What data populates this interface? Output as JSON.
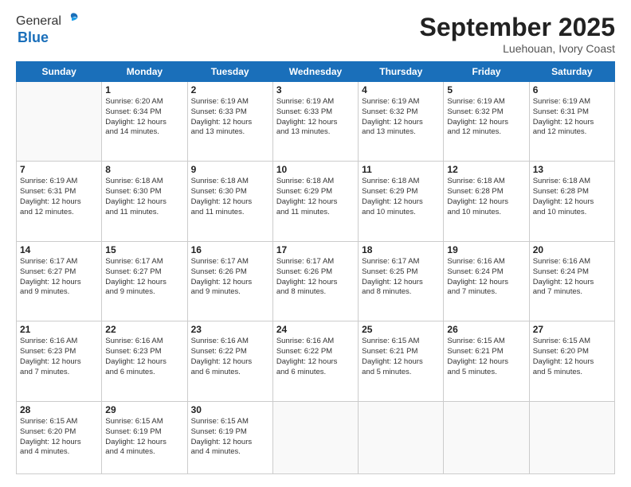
{
  "logo": {
    "general": "General",
    "blue": "Blue"
  },
  "header": {
    "month": "September 2025",
    "location": "Luehouan, Ivory Coast"
  },
  "weekdays": [
    "Sunday",
    "Monday",
    "Tuesday",
    "Wednesday",
    "Thursday",
    "Friday",
    "Saturday"
  ],
  "weeks": [
    [
      {
        "day": "",
        "info": ""
      },
      {
        "day": "1",
        "info": "Sunrise: 6:20 AM\nSunset: 6:34 PM\nDaylight: 12 hours\nand 14 minutes."
      },
      {
        "day": "2",
        "info": "Sunrise: 6:19 AM\nSunset: 6:33 PM\nDaylight: 12 hours\nand 13 minutes."
      },
      {
        "day": "3",
        "info": "Sunrise: 6:19 AM\nSunset: 6:33 PM\nDaylight: 12 hours\nand 13 minutes."
      },
      {
        "day": "4",
        "info": "Sunrise: 6:19 AM\nSunset: 6:32 PM\nDaylight: 12 hours\nand 13 minutes."
      },
      {
        "day": "5",
        "info": "Sunrise: 6:19 AM\nSunset: 6:32 PM\nDaylight: 12 hours\nand 12 minutes."
      },
      {
        "day": "6",
        "info": "Sunrise: 6:19 AM\nSunset: 6:31 PM\nDaylight: 12 hours\nand 12 minutes."
      }
    ],
    [
      {
        "day": "7",
        "info": "Sunrise: 6:19 AM\nSunset: 6:31 PM\nDaylight: 12 hours\nand 12 minutes."
      },
      {
        "day": "8",
        "info": "Sunrise: 6:18 AM\nSunset: 6:30 PM\nDaylight: 12 hours\nand 11 minutes."
      },
      {
        "day": "9",
        "info": "Sunrise: 6:18 AM\nSunset: 6:30 PM\nDaylight: 12 hours\nand 11 minutes."
      },
      {
        "day": "10",
        "info": "Sunrise: 6:18 AM\nSunset: 6:29 PM\nDaylight: 12 hours\nand 11 minutes."
      },
      {
        "day": "11",
        "info": "Sunrise: 6:18 AM\nSunset: 6:29 PM\nDaylight: 12 hours\nand 10 minutes."
      },
      {
        "day": "12",
        "info": "Sunrise: 6:18 AM\nSunset: 6:28 PM\nDaylight: 12 hours\nand 10 minutes."
      },
      {
        "day": "13",
        "info": "Sunrise: 6:18 AM\nSunset: 6:28 PM\nDaylight: 12 hours\nand 10 minutes."
      }
    ],
    [
      {
        "day": "14",
        "info": "Sunrise: 6:17 AM\nSunset: 6:27 PM\nDaylight: 12 hours\nand 9 minutes."
      },
      {
        "day": "15",
        "info": "Sunrise: 6:17 AM\nSunset: 6:27 PM\nDaylight: 12 hours\nand 9 minutes."
      },
      {
        "day": "16",
        "info": "Sunrise: 6:17 AM\nSunset: 6:26 PM\nDaylight: 12 hours\nand 9 minutes."
      },
      {
        "day": "17",
        "info": "Sunrise: 6:17 AM\nSunset: 6:26 PM\nDaylight: 12 hours\nand 8 minutes."
      },
      {
        "day": "18",
        "info": "Sunrise: 6:17 AM\nSunset: 6:25 PM\nDaylight: 12 hours\nand 8 minutes."
      },
      {
        "day": "19",
        "info": "Sunrise: 6:16 AM\nSunset: 6:24 PM\nDaylight: 12 hours\nand 7 minutes."
      },
      {
        "day": "20",
        "info": "Sunrise: 6:16 AM\nSunset: 6:24 PM\nDaylight: 12 hours\nand 7 minutes."
      }
    ],
    [
      {
        "day": "21",
        "info": "Sunrise: 6:16 AM\nSunset: 6:23 PM\nDaylight: 12 hours\nand 7 minutes."
      },
      {
        "day": "22",
        "info": "Sunrise: 6:16 AM\nSunset: 6:23 PM\nDaylight: 12 hours\nand 6 minutes."
      },
      {
        "day": "23",
        "info": "Sunrise: 6:16 AM\nSunset: 6:22 PM\nDaylight: 12 hours\nand 6 minutes."
      },
      {
        "day": "24",
        "info": "Sunrise: 6:16 AM\nSunset: 6:22 PM\nDaylight: 12 hours\nand 6 minutes."
      },
      {
        "day": "25",
        "info": "Sunrise: 6:15 AM\nSunset: 6:21 PM\nDaylight: 12 hours\nand 5 minutes."
      },
      {
        "day": "26",
        "info": "Sunrise: 6:15 AM\nSunset: 6:21 PM\nDaylight: 12 hours\nand 5 minutes."
      },
      {
        "day": "27",
        "info": "Sunrise: 6:15 AM\nSunset: 6:20 PM\nDaylight: 12 hours\nand 5 minutes."
      }
    ],
    [
      {
        "day": "28",
        "info": "Sunrise: 6:15 AM\nSunset: 6:20 PM\nDaylight: 12 hours\nand 4 minutes."
      },
      {
        "day": "29",
        "info": "Sunrise: 6:15 AM\nSunset: 6:19 PM\nDaylight: 12 hours\nand 4 minutes."
      },
      {
        "day": "30",
        "info": "Sunrise: 6:15 AM\nSunset: 6:19 PM\nDaylight: 12 hours\nand 4 minutes."
      },
      {
        "day": "",
        "info": ""
      },
      {
        "day": "",
        "info": ""
      },
      {
        "day": "",
        "info": ""
      },
      {
        "day": "",
        "info": ""
      }
    ]
  ]
}
